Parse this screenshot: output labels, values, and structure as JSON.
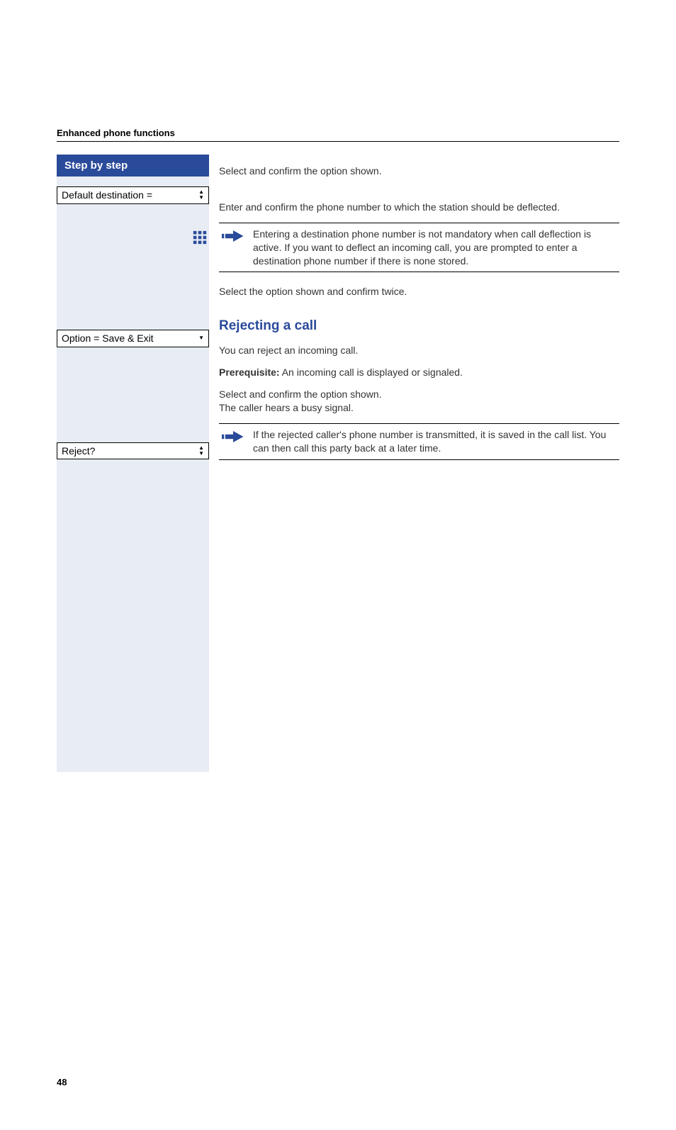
{
  "header": {
    "section_title": "Enhanced phone functions"
  },
  "sidebar": {
    "heading": "Step by step",
    "items": [
      {
        "label": "Default destination =",
        "arrows": "both"
      },
      {
        "label": "Option = Save & Exit",
        "arrows": "down"
      },
      {
        "label": "Reject?",
        "arrows": "both"
      }
    ]
  },
  "body": {
    "p1": "Select and confirm the option shown.",
    "p2": "Enter and confirm the phone number to which the station should be deflected.",
    "note1": "Entering a destination phone number is not mandatory when call deflection is active. If you want to deflect an incoming call, you are prompted to enter a destination phone number if there is none stored.",
    "p3": "Select the option shown and confirm twice.",
    "heading": "Rejecting a call",
    "p4": "You can reject an incoming call.",
    "p5_prefix": "Prerequisite:",
    "p5_rest": " An incoming call is displayed or signaled.",
    "p6a": "Select and confirm the option shown.",
    "p6b": "The caller hears a busy signal.",
    "note2": "If the rejected caller's phone number is transmitted, it is saved in the call list. You can then call this party back at a later time."
  },
  "footer": {
    "page": "48"
  }
}
